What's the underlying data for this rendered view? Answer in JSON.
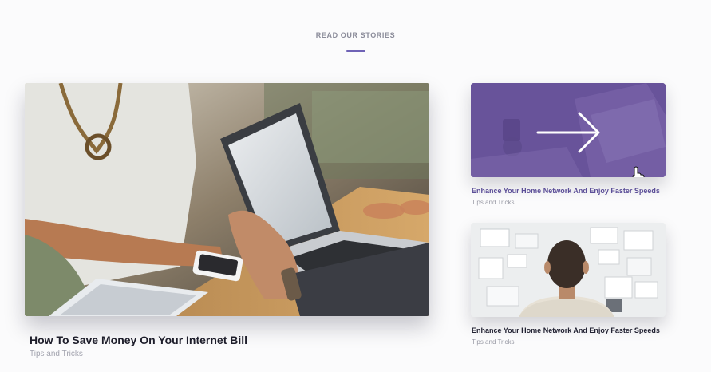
{
  "section": {
    "title": "READ OUR STORIES",
    "accent_color": "#6f63b6"
  },
  "featured": {
    "title": "How To Save Money On Your Internet Bill",
    "category": "Tips and Tricks",
    "image": "photo-laptop-meeting"
  },
  "stories": [
    {
      "title": "Enhance Your Home Network And Enjoy Faster Speeds",
      "category": "Tips and Tricks",
      "image": "photo-laptop-desk",
      "overlay_color": "#6a5299",
      "overlay_icon": "arrow-right-icon",
      "hovered": true
    },
    {
      "title": "Enhance Your Home Network And Enjoy Faster Speeds",
      "category": "Tips and Tricks",
      "image": "photo-man-at-wall"
    }
  ]
}
